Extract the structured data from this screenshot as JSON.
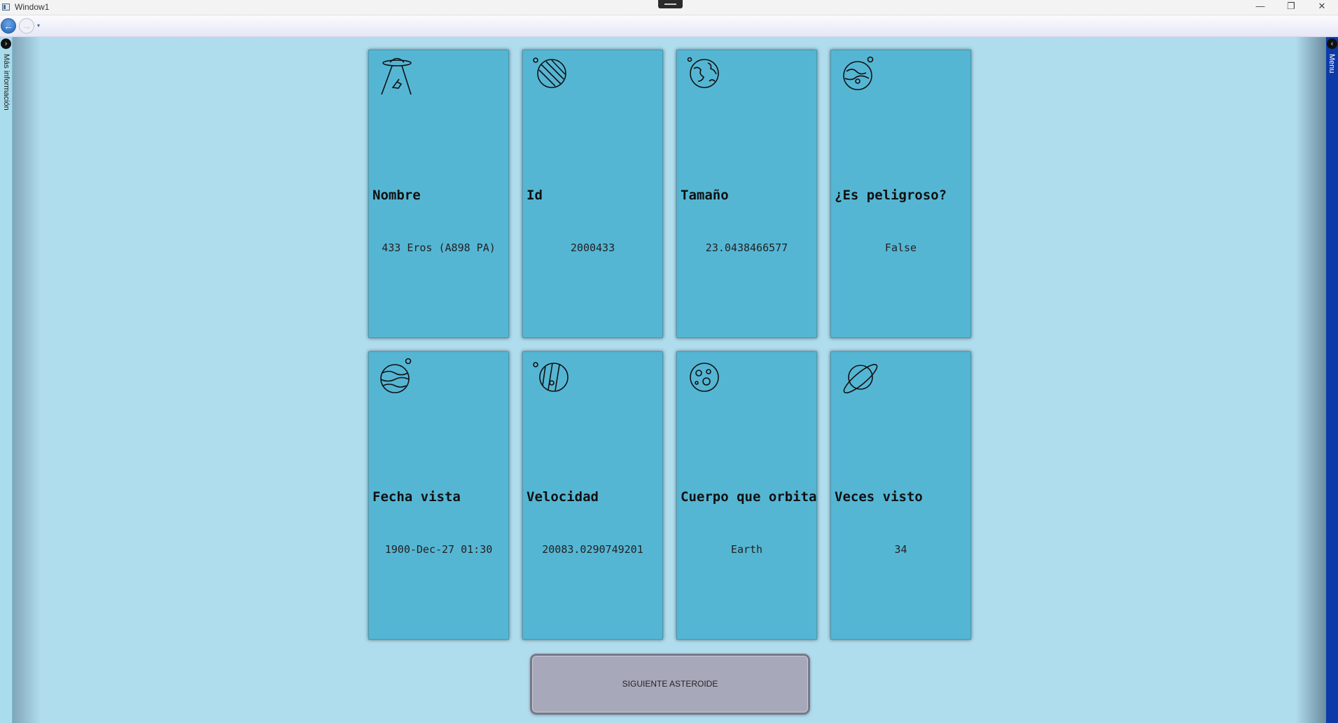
{
  "window": {
    "title": "Window1",
    "minimize_glyph": "—",
    "maximize_glyph": "❐",
    "close_glyph": "✕"
  },
  "nav": {
    "back_glyph": "←",
    "forward_glyph": "→",
    "dropdown_glyph": "▾"
  },
  "left_flyout": {
    "toggle_glyph": "›",
    "label": "Más información"
  },
  "right_flyout": {
    "toggle_glyph": "‹",
    "label": "Menu"
  },
  "cards": [
    {
      "label": "Nombre",
      "value": "433 Eros (A898 PA)",
      "icon": "ufo-icon"
    },
    {
      "label": "Id",
      "value": "2000433",
      "icon": "striped-planet-icon"
    },
    {
      "label": "Tamaño",
      "value": "23.0438466577",
      "icon": "earth-globe-icon"
    },
    {
      "label": "¿Es peligroso?",
      "value": "False",
      "icon": "planet-with-moon-icon"
    },
    {
      "label": "Fecha vista",
      "value": "1900-Dec-27 01:30",
      "icon": "gas-planet-moon-icon"
    },
    {
      "label": "Velocidad",
      "value": "20083.0290749201",
      "icon": "banded-planet-icon"
    },
    {
      "label": "Cuerpo que orbita",
      "value": "Earth",
      "icon": "moon-craters-icon"
    },
    {
      "label": "Veces visto",
      "value": "34",
      "icon": "ringed-planet-icon"
    }
  ],
  "next_button": {
    "label": "SIGUIENTE ASTEROIDE"
  },
  "colors": {
    "background": "#b0ddee",
    "card": "#55b6d4",
    "button": "#a8a8bb",
    "right_flyout": "#0c3aa8"
  }
}
